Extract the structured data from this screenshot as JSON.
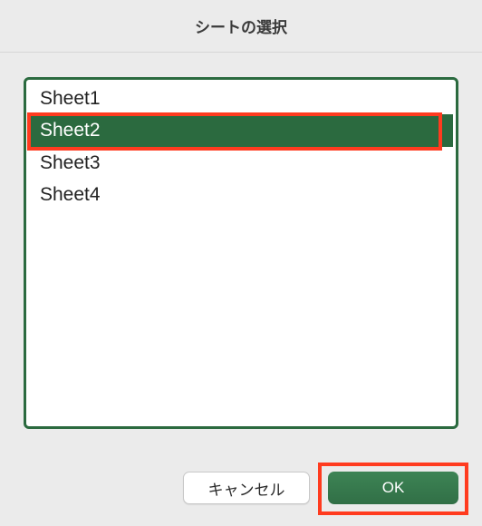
{
  "dialog": {
    "title": "シートの選択"
  },
  "sheets": {
    "items": [
      {
        "label": "Sheet1",
        "selected": false
      },
      {
        "label": "Sheet2",
        "selected": true
      },
      {
        "label": "Sheet3",
        "selected": false
      },
      {
        "label": "Sheet4",
        "selected": false
      }
    ]
  },
  "buttons": {
    "cancel_label": "キャンセル",
    "ok_label": "OK"
  },
  "annotations": {
    "highlight_selected_item": true,
    "highlight_ok_button": true
  },
  "colors": {
    "accent": "#2b6a3f",
    "highlight": "#ff3b1f"
  }
}
